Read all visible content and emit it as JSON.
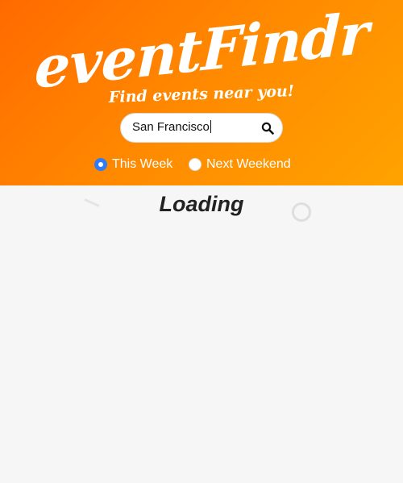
{
  "header": {
    "logo": "eventFindr",
    "tagline": "Find events near you!"
  },
  "search": {
    "value": "San Francisco",
    "icon": "search-icon"
  },
  "filters": [
    {
      "label": "This Week",
      "checked": true
    },
    {
      "label": "Next Weekend",
      "checked": false
    }
  ],
  "main": {
    "status": "Loading"
  },
  "colors": {
    "accent_start": "#ff6a00",
    "accent_end": "#ffa300",
    "radio_selected": "#2f7cf6"
  }
}
